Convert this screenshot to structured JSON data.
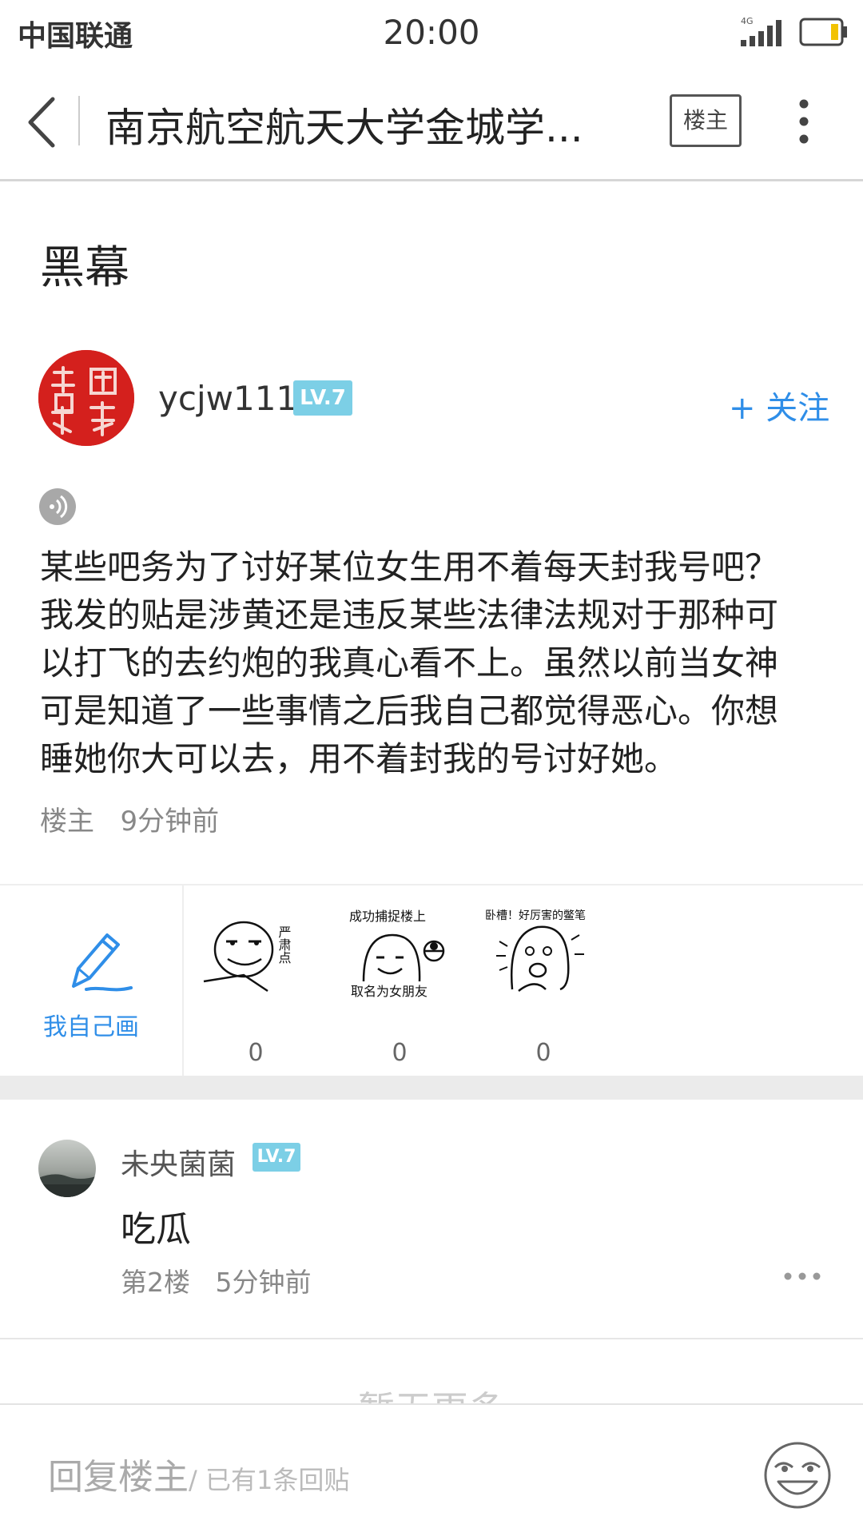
{
  "status_bar": {
    "carrier": "中国联通",
    "time": "20:00",
    "network": "4G"
  },
  "nav": {
    "title": "南京航空航天大学金城学...",
    "owner_button": "楼主"
  },
  "post": {
    "title": "黑幕",
    "author": "ycjw111",
    "level": "LV.7",
    "follow_label": "+ 关注",
    "body": "某些吧务为了讨好某位女生用不着每天封我号吧？我发的贴是涉黄还是违反某些法律法规对于那种可以打飞的去约炮的我真心看不上。虽然以前当女神可是知道了一些事情之后我自己都觉得恶心。你想睡她你大可以去，用不着封我的号讨好她。",
    "floor": "楼主",
    "time": "9分钟前"
  },
  "stickers": {
    "draw_label": "我自己画",
    "items": [
      {
        "caption": "严肃点",
        "count": "0"
      },
      {
        "caption_top": "成功捕捉楼上",
        "caption_bottom": "取名为女朋友",
        "count": "0"
      },
      {
        "caption": "卧槽！好厉害的鳖笔",
        "count": "0"
      }
    ]
  },
  "reply": {
    "author": "未央菌菌",
    "level": "LV.7",
    "content": "吃瓜",
    "floor": "第2楼",
    "time": "5分钟前"
  },
  "no_more": "暂无更多",
  "bottom": {
    "placeholder": "回复楼主",
    "count_text": "/ 已有1条回贴"
  },
  "colors": {
    "accent": "#2f8ee8",
    "level_badge": "#7ccfe6",
    "seal_red": "#d4201d"
  }
}
